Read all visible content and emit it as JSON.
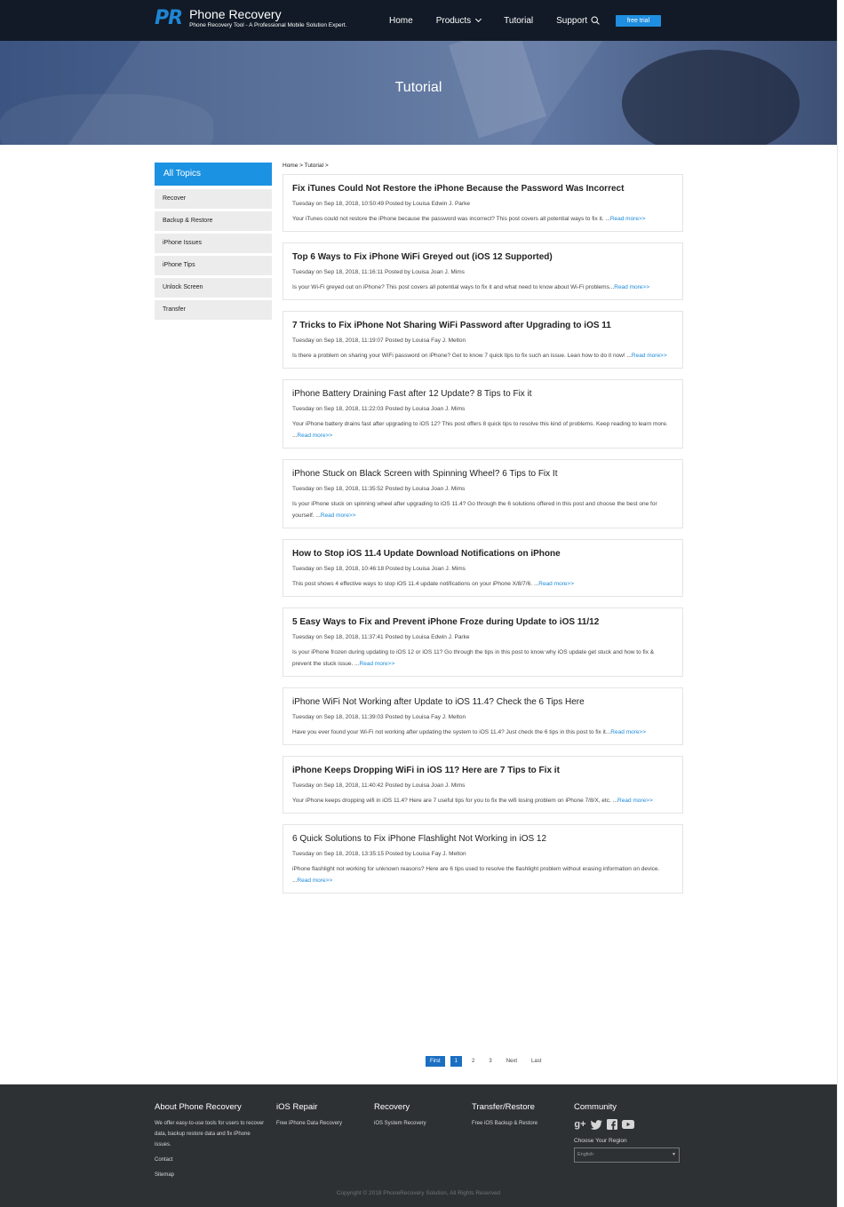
{
  "header": {
    "logo_mark": "PR",
    "logo_title": "Phone Recovery",
    "logo_subtitle": "Phone Recovery Tool - A Professional Mobile Solution Expert.",
    "nav": [
      "Home",
      "Products",
      "Tutorial",
      "Support"
    ],
    "free_trial": "free trial",
    "accent_color": "#1f8ee0"
  },
  "hero": {
    "title": "Tutorial"
  },
  "sidebar": {
    "heading": "All Topics",
    "items": [
      "Recover",
      "Backup & Restore",
      "iPhone Issues",
      "iPhone Tips",
      "Unlock Screen",
      "Transfer"
    ]
  },
  "breadcrumb": "Home > Tutorial >",
  "posts": [
    {
      "title": "Fix iTunes Could Not Restore the iPhone Because the Password Was Incorrect",
      "bold": true,
      "meta": "Tuesday on Sep 18, 2018, 10:50:49 Posted by Louisa Edwin J. Parke",
      "excerpt": "Your iTunes could not restore the iPhone because the password was incorrect? This post covers all potential ways to fix it. ...",
      "more": "Read more>>"
    },
    {
      "title": "Top 6 Ways to Fix iPhone WiFi Greyed out (iOS 12 Supported)",
      "bold": true,
      "meta": "Tuesday on Sep 18, 2018, 11:16:11 Posted by Louisa Joan J. Mims",
      "excerpt": "Is your Wi-Fi greyed out on iPhone? This post covers all potential ways to fix it and what need to know about Wi-Fi problems...",
      "more": "Read more>>"
    },
    {
      "title": "7 Tricks to Fix iPhone Not Sharing WiFi Password after Upgrading to iOS 11",
      "bold": true,
      "meta": "Tuesday on Sep 18, 2018, 11:19:07 Posted by Louisa Fay J. Melton",
      "excerpt": "Is there a problem on sharing your WiFi password on iPhone? Get to know 7 quick tips to fix such an issue. Lean how to do it now! ...",
      "more": "Read more>>"
    },
    {
      "title": "iPhone Battery Draining Fast after 12 Update? 8 Tips to Fix it",
      "bold": false,
      "meta": "Tuesday on Sep 18, 2018, 11:22:03 Posted by Louisa Joan J. Mims",
      "excerpt": "Your iPhone battery drains fast after upgrading to iOS 12? This post offers 8 quick tips to resolve this kind of problems. Keep reading to learn more. ...",
      "more": "Read more>>"
    },
    {
      "title": "iPhone Stuck on Black Screen with Spinning Wheel? 6 Tips to Fix It",
      "bold": false,
      "meta": "Tuesday on Sep 18, 2018, 11:35:52 Posted by Louisa Joan J. Mims",
      "excerpt": "Is your iPhone stuck on spinning wheel after upgrading to iOS 11.4? Go through the 6 solutions offered in this post and choose the best one for yourself. ...",
      "more": "Read more>>"
    },
    {
      "title": "How to Stop iOS 11.4 Update Download Notifications on iPhone",
      "bold": true,
      "meta": "Tuesday on Sep 18, 2018, 10:46:18 Posted by Louisa Joan J. Mims",
      "excerpt": "This post shows 4 effective ways to stop iOS 11.4 update notifications on your iPhone X/8/7/6. ...",
      "more": "Read more>>"
    },
    {
      "title": "5 Easy Ways to Fix and Prevent iPhone Froze during Update to iOS 11/12",
      "bold": true,
      "meta": "Tuesday on Sep 18, 2018, 11:37:41 Posted by Louisa Edwin J. Parke",
      "excerpt": "Is your iPhone frozen during updating to iOS 12 or iOS 11? Go through the tips in this post to know why iOS update get stuck and how to fix & prevent the stuck issue. ...",
      "more": "Read more>>"
    },
    {
      "title": "iPhone WiFi Not Working after Update to iOS 11.4? Check the 6 Tips Here",
      "bold": false,
      "meta": "Tuesday on Sep 18, 2018, 11:39:03 Posted by Louisa Fay J. Melton",
      "excerpt": "Have you ever found your Wi-Fi not working after updating the system to iOS 11.4? Just check the 6 tips in this post to fix it...",
      "more": "Read more>>"
    },
    {
      "title": "iPhone Keeps Dropping WiFi in iOS 11? Here are 7 Tips to Fix it",
      "bold": true,
      "meta": "Tuesday on Sep 18, 2018, 11:40:42 Posted by Louisa Joan J. Mims",
      "excerpt": "Your iPhone keeps dropping wifi in iOS 11.4? Here are 7 useful tips for you to fix the wifi losing problem on iPhone 7/8/X, etc. ...",
      "more": "Read more>>"
    },
    {
      "title": "6 Quick Solutions to Fix iPhone Flashlight Not Working in iOS 12",
      "bold": false,
      "meta": "Tuesday on Sep 18, 2018, 13:35:15 Posted by Louisa Fay J. Melton",
      "excerpt": "iPhone flashlight not working for unknown reasons? Here are 6 tips used to resolve the flashlight problem without erasing information on device. ...",
      "more": "Read more>>"
    }
  ],
  "pagination": [
    "First",
    "1",
    "2",
    "3",
    "Next",
    "Last"
  ],
  "footer": {
    "about_heading": "About Phone Recovery",
    "about_text": "We offer easy-to-use tools for users to recover data, backup restore data and fix iPhone issues.",
    "contact": "Contact",
    "sitemap": "Sitemap",
    "ios_repair_heading": "iOS Repair",
    "ios_repair_link": "Free iPhone Data Recovery",
    "recovery_heading": "Recovery",
    "recovery_link": "iOS System Recovery",
    "transfer_heading": "Transfer/Restore",
    "transfer_link": "Free iOS Backup & Restore",
    "community_heading": "Community",
    "social_icons": [
      "google-plus-icon",
      "twitter-icon",
      "facebook-icon",
      "youtube-icon"
    ],
    "region_label": "Choose Your Region",
    "region_value": "English",
    "copyright": "Copyright © 2018 PhoneRecovery Solution, All Rights Reserved"
  }
}
